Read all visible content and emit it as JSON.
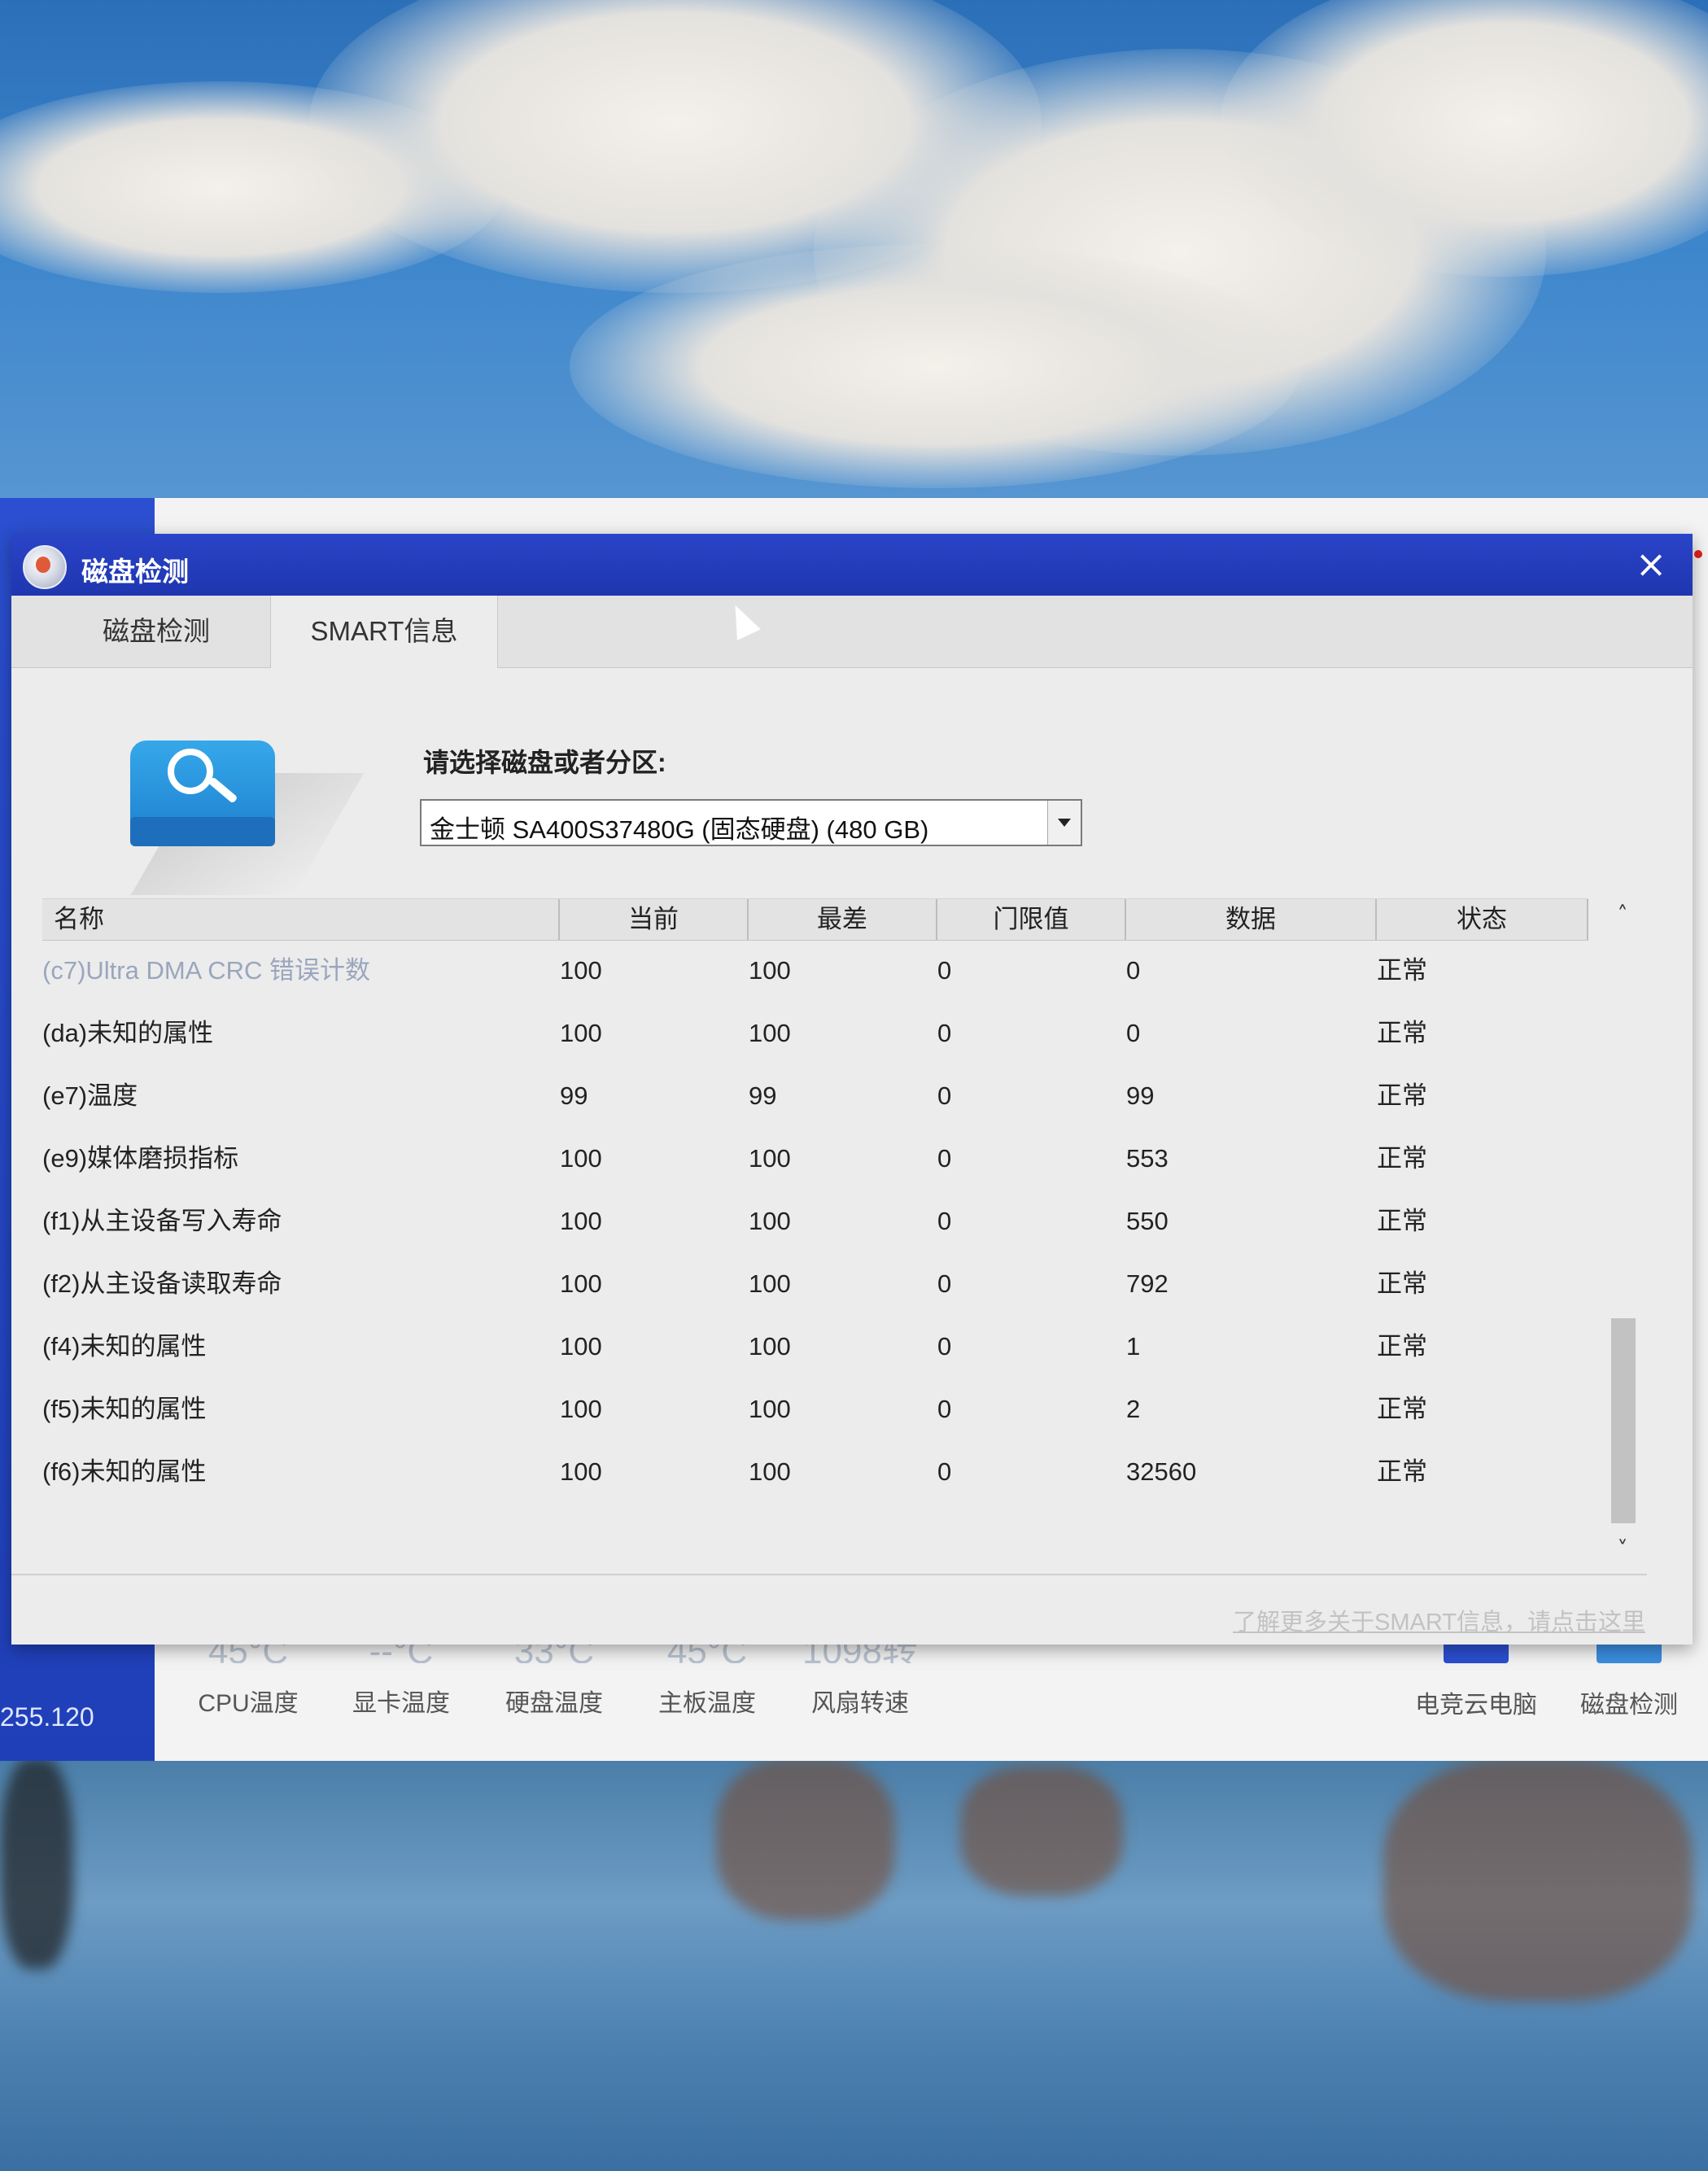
{
  "background_app": {
    "ip_text": "255.120",
    "stats": [
      {
        "value": "45°C",
        "label": "CPU温度"
      },
      {
        "value": "--°C",
        "label": "显卡温度"
      },
      {
        "value": "33°C",
        "label": "硬盘温度"
      },
      {
        "value": "45°C",
        "label": "主板温度"
      },
      {
        "value": "1098转",
        "label": "风扇转速"
      }
    ],
    "tools": [
      {
        "label": "电竞云电脑"
      },
      {
        "label": "磁盘检测"
      }
    ]
  },
  "dialog": {
    "title": "磁盘检测",
    "close_glyph": "×",
    "tabs": [
      {
        "label": "磁盘检测",
        "active": false
      },
      {
        "label": "SMART信息",
        "active": true
      }
    ],
    "select": {
      "label": "请选择磁盘或者分区:",
      "value": "金士顿  SA400S37480G (固态硬盘)  (480 GB)"
    },
    "table": {
      "columns": [
        "名称",
        "当前",
        "最差",
        "门限值",
        "数据",
        "状态"
      ],
      "rows": [
        [
          "(c7)Ultra DMA CRC 错误计数",
          "100",
          "100",
          "0",
          "0",
          "正常"
        ],
        [
          "(da)未知的属性",
          "100",
          "100",
          "0",
          "0",
          "正常"
        ],
        [
          "(e7)温度",
          "99",
          "99",
          "0",
          "99",
          "正常"
        ],
        [
          "(e9)媒体磨损指标",
          "100",
          "100",
          "0",
          "553",
          "正常"
        ],
        [
          "(f1)从主设备写入寿命",
          "100",
          "100",
          "0",
          "550",
          "正常"
        ],
        [
          "(f2)从主设备读取寿命",
          "100",
          "100",
          "0",
          "792",
          "正常"
        ],
        [
          "(f4)未知的属性",
          "100",
          "100",
          "0",
          "1",
          "正常"
        ],
        [
          "(f5)未知的属性",
          "100",
          "100",
          "0",
          "2",
          "正常"
        ],
        [
          "(f6)未知的属性",
          "100",
          "100",
          "0",
          "32560",
          "正常"
        ]
      ]
    },
    "scroll": {
      "up_glyph": "˄",
      "down_glyph": "˅"
    },
    "help_link": "了解更多关于SMART信息，请点击这里"
  },
  "colors": {
    "titlebar": "#2a44c8",
    "disk_icon": "#2a8fdc",
    "sidebar": "#2b4fd0"
  }
}
